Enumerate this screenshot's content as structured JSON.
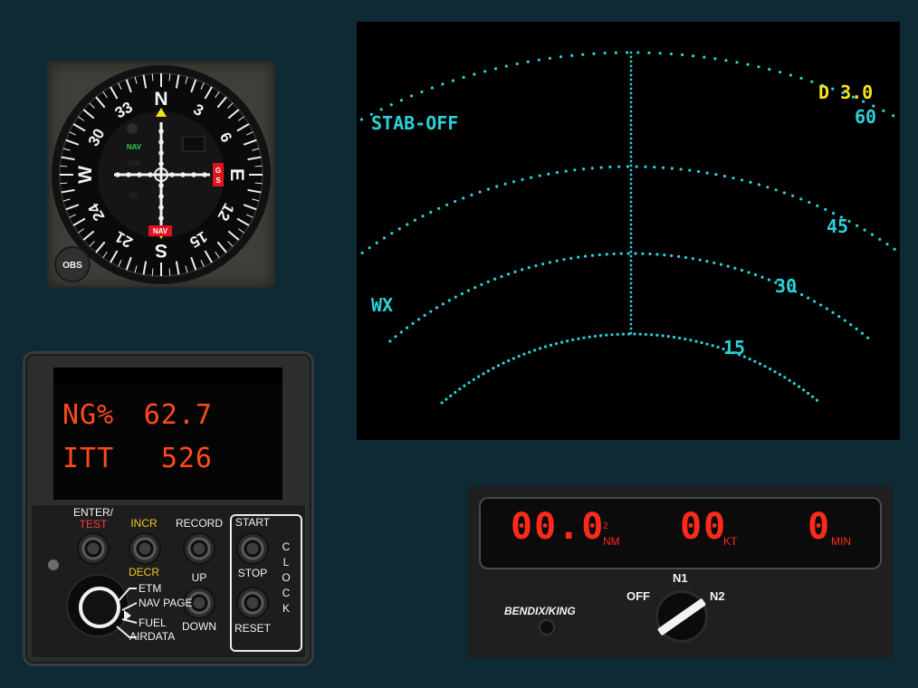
{
  "cdi": {
    "compass": [
      "N",
      "3",
      "6",
      "E",
      "12",
      "15",
      "S",
      "21",
      "24",
      "W",
      "30",
      "33"
    ],
    "nav_flag": "NAV",
    "off_label": "OFF",
    "dc_label": "DC",
    "to_from_flag": "NAV",
    "gs_flag_g": "G",
    "gs_flag_s": "S",
    "obs_button": "OBS"
  },
  "radar": {
    "mode": "STAB-OFF",
    "wx_label": "WX",
    "d_readout": "D 3.0",
    "range_labels": [
      "60",
      "45",
      "30",
      "15"
    ]
  },
  "edu": {
    "ng_label": "NG%",
    "ng_value": "62.7",
    "itt_label": "ITT",
    "itt_value": "526",
    "enter_label": "ENTER/",
    "test_label": "TEST",
    "incr_label": "INCR",
    "decr_label": "DECR",
    "record_label": "RECORD",
    "start_label": "START",
    "stop_label": "STOP",
    "up_label": "UP",
    "down_label": "DOWN",
    "reset_label": "RESET",
    "clock_letters": [
      "C",
      "L",
      "O",
      "C",
      "K"
    ],
    "rotary_items": [
      "ETM",
      "NAV PAGE",
      "FUEL",
      "AIRDATA"
    ]
  },
  "dme": {
    "distance": "00.0",
    "distance_superscript": "2",
    "distance_unit": "NM",
    "speed": "00",
    "speed_unit": "KT",
    "time": "0",
    "time_unit": "MIN",
    "brand": "BENDIX/KING",
    "selector_off": "OFF",
    "selector_n1": "N1",
    "selector_n2": "N2"
  },
  "colors": {
    "background": "#0d2a35",
    "radar_cyan": "#2ad1d8",
    "radar_yellow": "#f2e51e",
    "edu_orange": "#ff4a1c",
    "dme_red": "#ff2a1a",
    "nav_green": "#2fd24a",
    "flag_red": "#e0141e"
  }
}
